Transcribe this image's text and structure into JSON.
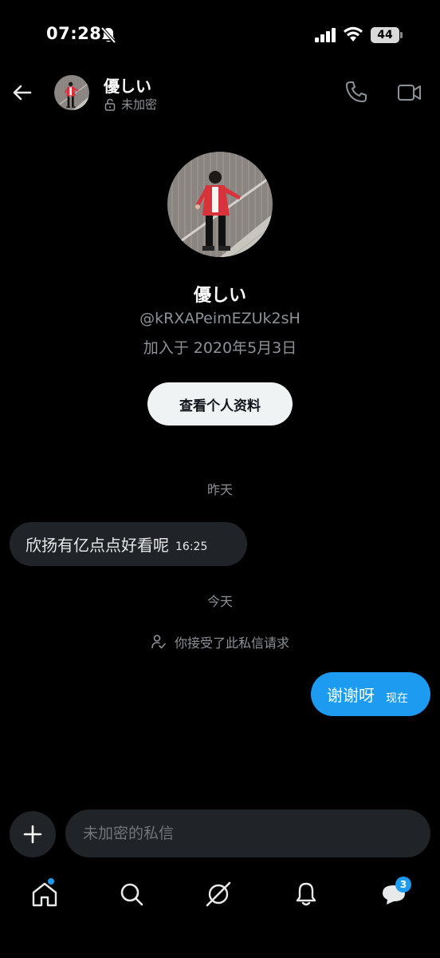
{
  "status_bar": {
    "time": "07:28",
    "battery": "44",
    "icons": [
      "bell-slash-icon",
      "cellular-signal-icon",
      "wifi-icon",
      "battery-icon"
    ]
  },
  "header": {
    "name": "優しい",
    "subtitle": "未加密",
    "icons": [
      "back-arrow-icon",
      "lock-open-icon",
      "phone-icon",
      "video-camera-icon"
    ]
  },
  "profile": {
    "name": "優しい",
    "handle": "@kRXAPeimEZUk2sH",
    "joined": "加入于 2020年5月3日",
    "view_profile_button": "查看个人资料"
  },
  "chat": {
    "date_yesterday": "昨天",
    "incoming": {
      "text": "欣扬有亿点点好看呢",
      "time": "16:25"
    },
    "date_today": "今天",
    "system_note": "你接受了此私信请求",
    "outgoing": {
      "text": "谢谢呀",
      "time": "现在"
    }
  },
  "composer": {
    "placeholder": "未加密的私信"
  },
  "bottom_nav": {
    "items": [
      "home-icon",
      "search-icon",
      "grok-icon",
      "notifications-bell-icon",
      "messages-icon"
    ],
    "messages_badge": "3"
  },
  "colors": {
    "background": "#000000",
    "accent": "#1d9bf0",
    "bubble_incoming": "#202327",
    "muted_text": "#8b9298"
  }
}
